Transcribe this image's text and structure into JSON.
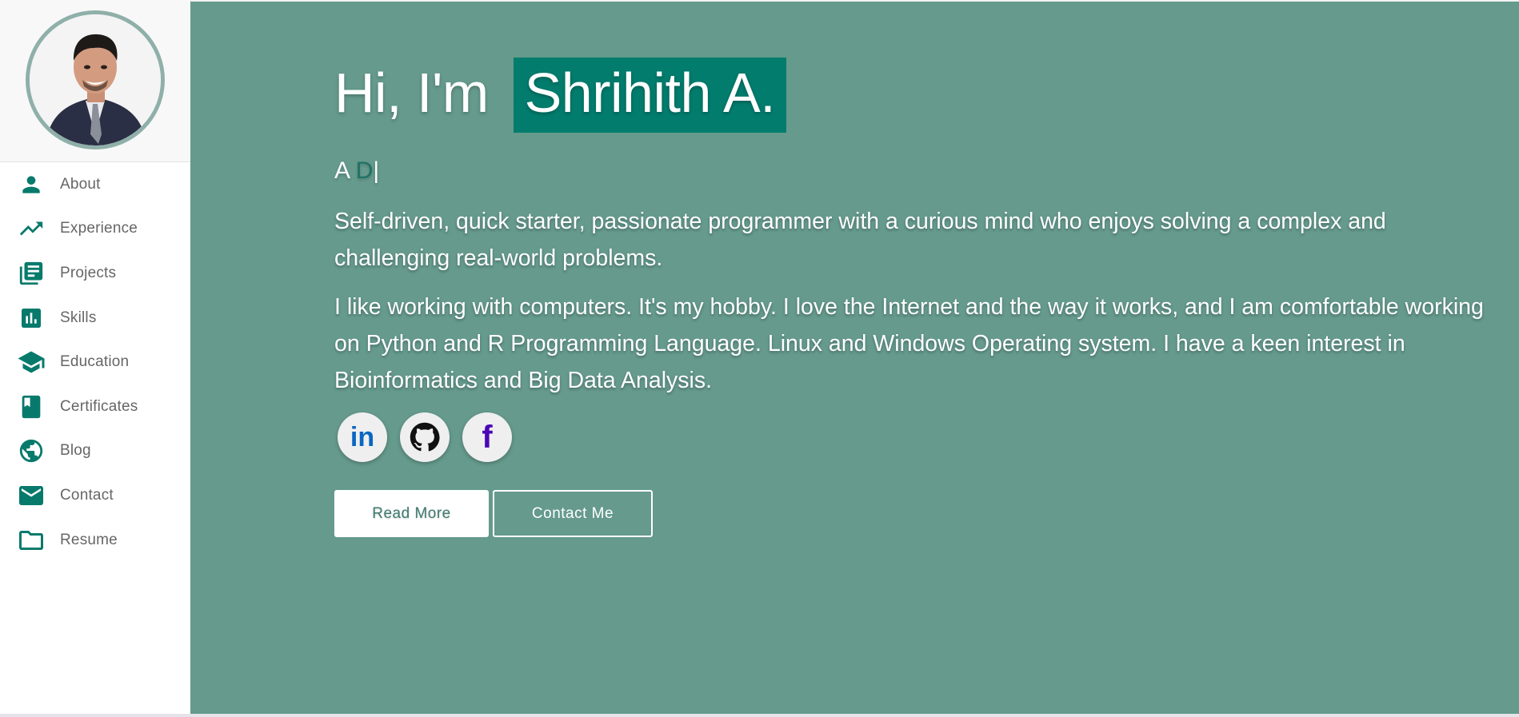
{
  "colors": {
    "sidebar_icon": "#077a6c",
    "main_bg": "#659a8c",
    "highlight": "#027c6d",
    "typed_accent": "#1f7265"
  },
  "sidebar": {
    "avatar_icon": "profile-photo",
    "items": [
      {
        "label": "About",
        "icon": "person-icon"
      },
      {
        "label": "Experience",
        "icon": "trending-up-icon"
      },
      {
        "label": "Projects",
        "icon": "library-books-icon"
      },
      {
        "label": "Skills",
        "icon": "bar-chart-icon"
      },
      {
        "label": "Education",
        "icon": "graduation-cap-icon"
      },
      {
        "label": "Certificates",
        "icon": "book-icon"
      },
      {
        "label": "Blog",
        "icon": "globe-icon"
      },
      {
        "label": "Contact",
        "icon": "mail-icon"
      },
      {
        "label": "Resume",
        "icon": "folder-icon"
      }
    ]
  },
  "hero": {
    "greeting": "Hi, I'm ",
    "name": "Shrihith A.",
    "typed_prefix": "A ",
    "typed_current": "D",
    "typed_caret": "|",
    "paragraph1": "Self-driven, quick starter, passionate programmer with a curious mind who enjoys solving a complex and challenging real-world problems.",
    "paragraph2": "I like working with computers. It's my hobby. I love the Internet and the way it works, and I am comfortable working on Python and R Programming Language. Linux and Windows Operating system. I have a keen interest in Bioinformatics and Big Data Analysis."
  },
  "social": {
    "linkedin_label": "in",
    "facebook_label": "f",
    "icons": [
      "linkedin-icon",
      "github-icon",
      "facebook-icon"
    ]
  },
  "buttons": {
    "read_more": "Read More",
    "contact_me": "Contact Me"
  }
}
